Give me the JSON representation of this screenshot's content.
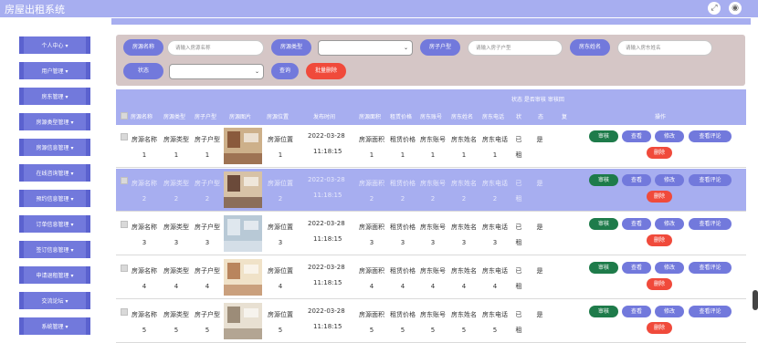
{
  "app": {
    "title": "房屋出租系统"
  },
  "top_icons": {
    "fullscreen": "expand-icon",
    "user": "user-icon"
  },
  "sidebar": {
    "items": [
      {
        "label": "个人中心 ▾"
      },
      {
        "label": "用户管理 ▾"
      },
      {
        "label": "房东管理 ▾"
      },
      {
        "label": "房源类型管理 ▾"
      },
      {
        "label": "房源信息管理 ▾"
      },
      {
        "label": "在线咨询管理 ▾"
      },
      {
        "label": "预约信息管理 ▾"
      },
      {
        "label": "订单信息管理 ▾"
      },
      {
        "label": "签订信息管理 ▾"
      },
      {
        "label": "申请退租管理 ▾"
      },
      {
        "label": "交流论坛 ▾"
      },
      {
        "label": "系统管理 ▾"
      }
    ]
  },
  "search": {
    "name_label": "房源名称",
    "name_placeholder": "请输入房源名称",
    "type_label": "房源类型",
    "layout_label": "房子户型",
    "layout_placeholder": "请输入房子户型",
    "owner_label": "房东姓名",
    "owner_placeholder": "请输入房东姓名",
    "status_label": "状态",
    "query_button": "查询",
    "batch_delete_button": "批量删除"
  },
  "table": {
    "extra_header": "状态 是否审核 审核回",
    "headers": [
      "房源名称",
      "房源类型",
      "房子户型",
      "房源图片",
      "房源位置",
      "发布时间",
      "房源面积",
      "租赁价格",
      "房东账号",
      "房东姓名",
      "房东电话",
      "状",
      "态",
      "复",
      "操作"
    ],
    "rows": [
      {
        "name": "房源名称1",
        "type": "房源类型1",
        "layout": "房子户型1",
        "location": "房源位置1",
        "date": "2022-03-28",
        "time": "11:18:15",
        "area": "房源面积1",
        "price": "租赁价格1",
        "account": "房东账号1",
        "owner": "房东姓名1",
        "phone": "房东电话1",
        "status": "已租",
        "audit": "是"
      },
      {
        "name": "房源名称2",
        "type": "房源类型2",
        "layout": "房子户型2",
        "location": "房源位置2",
        "date": "2022-03-28",
        "time": "11:18:15",
        "area": "房源面积2",
        "price": "租赁价格2",
        "account": "房东账号2",
        "owner": "房东姓名2",
        "phone": "房东电话2",
        "status": "已租",
        "audit": "是"
      },
      {
        "name": "房源名称3",
        "type": "房源类型3",
        "layout": "房子户型3",
        "location": "房源位置3",
        "date": "2022-03-28",
        "time": "11:18:15",
        "area": "房源面积3",
        "price": "租赁价格3",
        "account": "房东账号3",
        "owner": "房东姓名3",
        "phone": "房东电话3",
        "status": "已租",
        "audit": "是"
      },
      {
        "name": "房源名称4",
        "type": "房源类型4",
        "layout": "房子户型4",
        "location": "房源位置4",
        "date": "2022-03-28",
        "time": "11:18:15",
        "area": "房源面积4",
        "price": "租赁价格4",
        "account": "房东账号4",
        "owner": "房东姓名4",
        "phone": "房东电话4",
        "status": "已租",
        "audit": "是"
      },
      {
        "name": "房源名称5",
        "type": "房源类型5",
        "layout": "房子户型5",
        "location": "房源位置5",
        "date": "2022-03-28",
        "time": "11:18:15",
        "area": "房源面积5",
        "price": "租赁价格5",
        "account": "房东账号5",
        "owner": "房东姓名5",
        "phone": "房东电话5",
        "status": "已租",
        "audit": "是"
      }
    ],
    "actions": {
      "audit": "审核",
      "view": "查看",
      "edit": "修改",
      "comment": "查看评论",
      "delete": "删除"
    }
  },
  "colors": {
    "accent": "#7279dc",
    "header": "#a7aef0",
    "danger": "#f04a3b",
    "audit": "#1e7b4a"
  }
}
